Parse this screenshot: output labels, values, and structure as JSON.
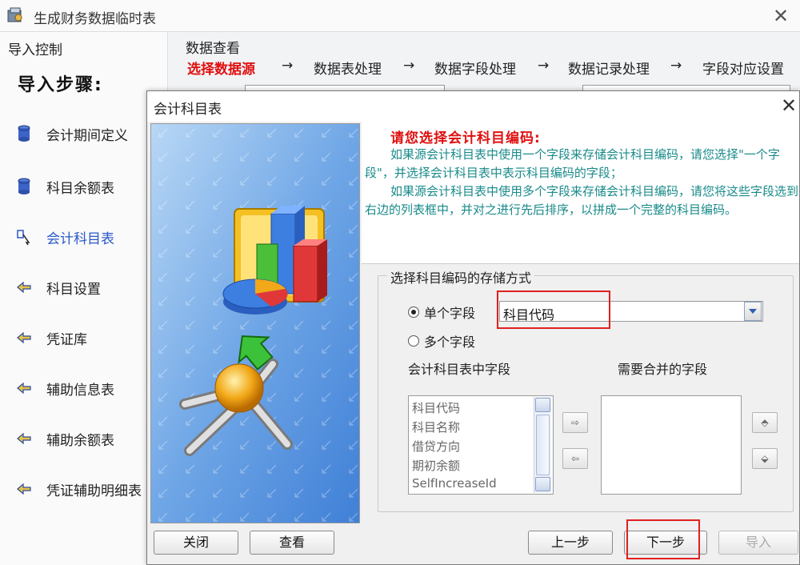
{
  "main_window": {
    "title": "生成财务数据临时表",
    "left_panel": {
      "header": "导入控制",
      "steps_title": "导入步骤:",
      "steps": [
        {
          "label": "会计期间定义",
          "icon": "database-icon",
          "active": false
        },
        {
          "label": "科目余额表",
          "icon": "database-icon",
          "active": false
        },
        {
          "label": "会计科目表",
          "icon": "search-pointer-icon",
          "active": true
        },
        {
          "label": "科目设置",
          "icon": "arrow-in-icon",
          "active": false
        },
        {
          "label": "凭证库",
          "icon": "arrow-in-icon",
          "active": false
        },
        {
          "label": "辅助信息表",
          "icon": "arrow-in-icon",
          "active": false
        },
        {
          "label": "辅助余额表",
          "icon": "arrow-in-icon",
          "active": false
        },
        {
          "label": "凭证辅助明细表",
          "icon": "arrow-in-icon",
          "active": false
        }
      ]
    },
    "data_view": {
      "header": "数据查看",
      "flow": [
        "选择数据源",
        "数据表处理",
        "数据字段处理",
        "数据记录处理",
        "字段对应设置"
      ],
      "flow_arrow": "→"
    }
  },
  "dialog": {
    "title": "会计科目表",
    "info_title": "请您选择会计科目编码:",
    "info_paragraph_1": "如果源会计科目表中使用一个字段来存储会计科目编码，请您选择\"一个字段\"，并选择会计科目表中表示科目编码的字段；",
    "info_paragraph_2": "如果源会计科目表中使用多个字段来存储会计科目编码，请您将这些字段选到右边的列表框中，并对之进行先后排序，以拼成一个完整的科目编码。",
    "storage_group_title": "选择科目编码的存储方式",
    "radio_single": "单个字段",
    "radio_multiple": "多个字段",
    "single_field_value": "科目代码",
    "left_list_label": "会计科目表中字段",
    "right_list_label": "需要合并的字段",
    "left_list_items": [
      "科目代码",
      "科目名称",
      "借贷方向",
      "期初余额",
      "SelfIncreaseId"
    ],
    "move_right": "⇨",
    "move_left": "⇦",
    "move_up": "⬘",
    "move_down": "⬙",
    "buttons": {
      "close": "关闭",
      "view": "查看",
      "prev": "上一步",
      "next": "下一步",
      "import": "导入"
    }
  },
  "colors": {
    "highlight_box": "#e02020",
    "current_step": "#e01010",
    "info_text": "#1a8a8a"
  }
}
